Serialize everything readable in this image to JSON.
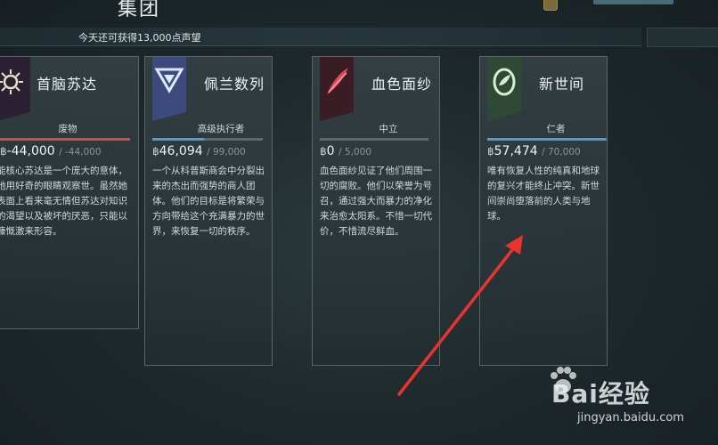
{
  "page": {
    "title": "集团"
  },
  "banner": {
    "reputation_text": "今天还可获得13,000点声望"
  },
  "colors": {
    "hostile": "#d24a4a",
    "friendly": "#4c9fd6",
    "neutral": "#7b878b",
    "arrow": "#e8332f"
  },
  "factions": [
    {
      "name": "首脑苏达",
      "standing": "废物",
      "rep_symbol": "฿",
      "rep_value": "-44,000",
      "rep_max": "/ -44,000",
      "rep_fraction": 1.0,
      "icon": "suda-sun-icon",
      "description": "能核心苏达是一个庞大的意体，她用好奇的眼睛观察世。虽然她表面上看来毫无情但苏达对知识的渴望以及被坏的厌恶，只能以慷慨激来形容。"
    },
    {
      "name": "佩兰数列",
      "standing": "高级执行者",
      "rep_symbol": "฿",
      "rep_value": "46,094",
      "rep_max": "/ 99,000",
      "rep_fraction": 0.466,
      "icon": "perrin-triangle-icon",
      "description": "一个从科普斯商会中分裂出来的杰出而强势的商人团体。他们的目标是将繁荣与方向带给这个充满暴力的世界，来恢复一切的秩序。"
    },
    {
      "name": "血色面纱",
      "standing": "中立",
      "rep_symbol": "฿",
      "rep_value": "0",
      "rep_max": "/ 5,000",
      "rep_fraction": 0.0,
      "icon": "red-veil-feather-icon",
      "description": "血色面纱见证了他们周围一切的腐败。他们以荣誉为号召，通过强大而暴力的净化来治愈太阳系。不惜一切代价，不惜流尽鲜血。"
    },
    {
      "name": "新世间",
      "standing": "仁者",
      "rep_symbol": "฿",
      "rep_value": "57,474",
      "rep_max": "/ 70,000",
      "rep_fraction": 0.821,
      "icon": "new-loka-seed-icon",
      "description": "唯有恢复人性的纯真和地球的复兴才能终止冲突。新世间崇尚堕落前的人类与地球。"
    }
  ],
  "watermark": {
    "brand": "Bai经验",
    "url": "jingyan.baidu.com"
  }
}
